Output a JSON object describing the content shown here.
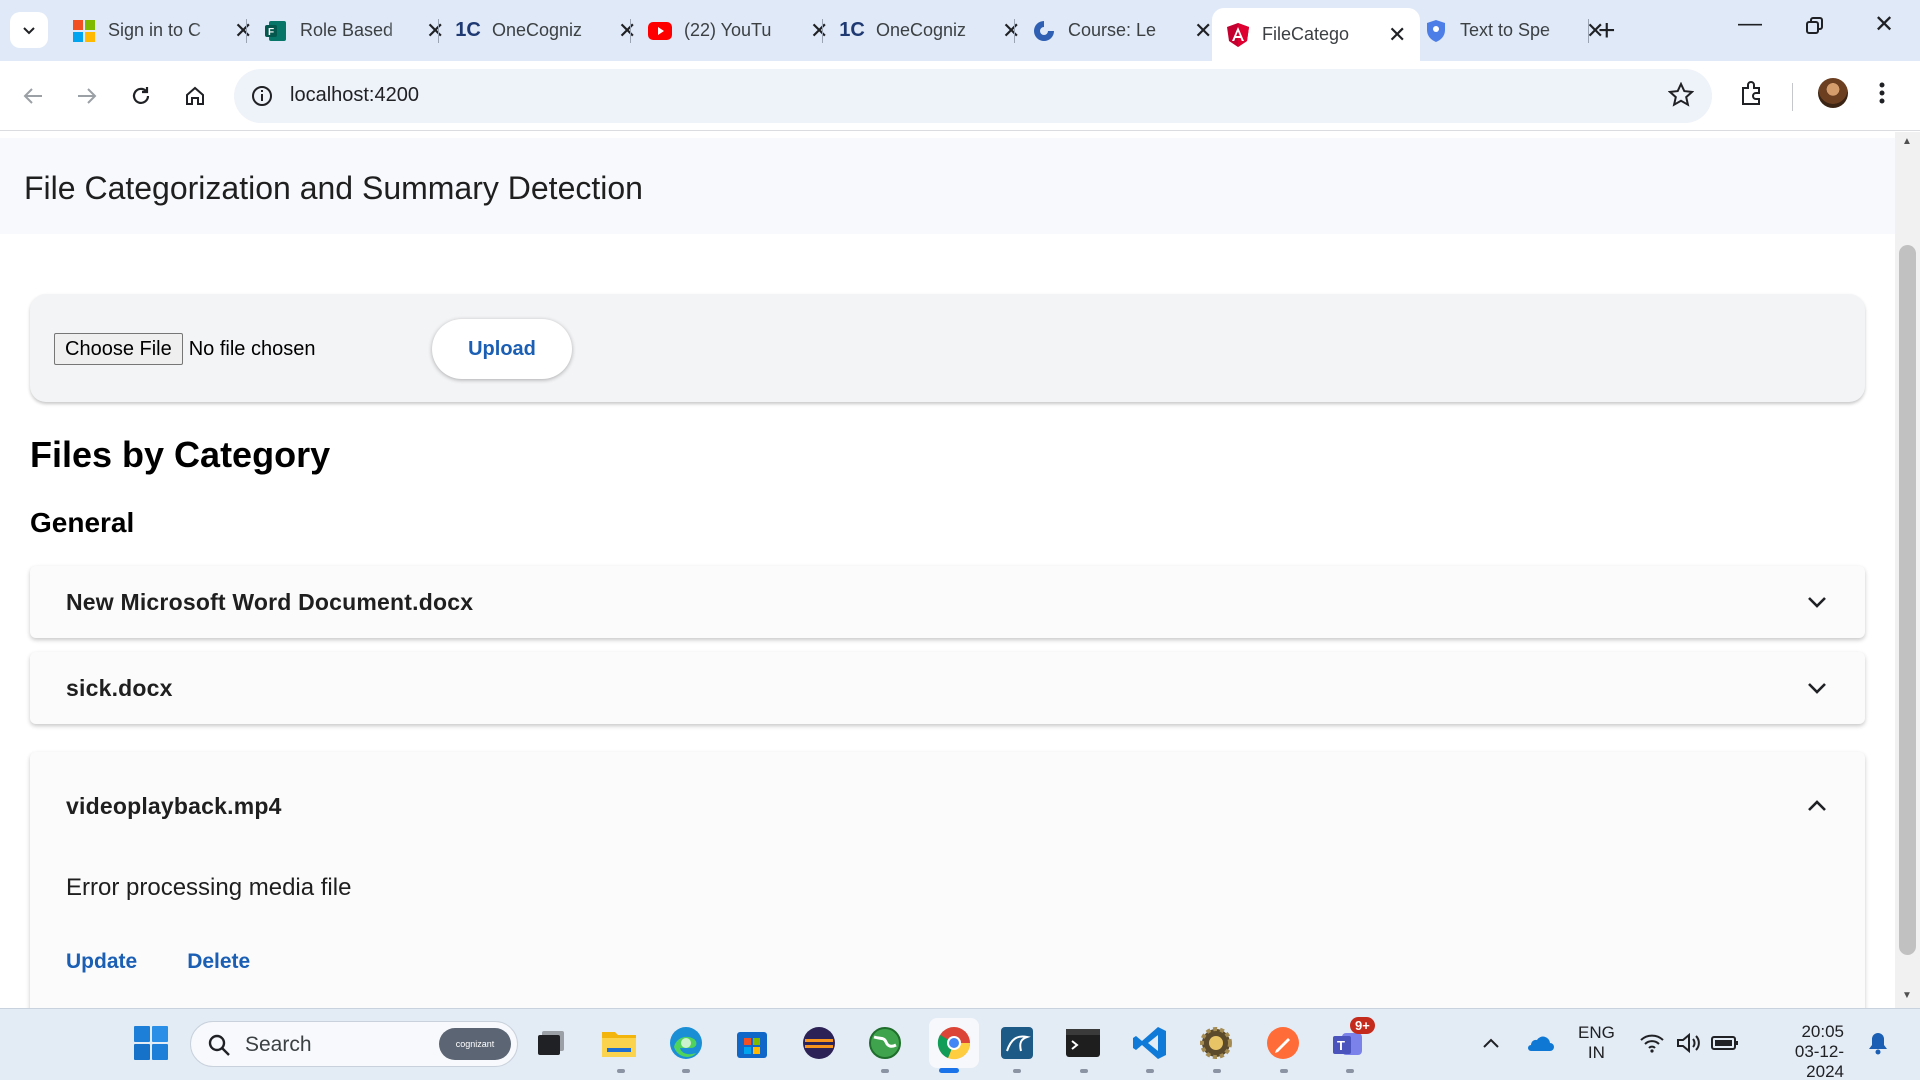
{
  "browser": {
    "tabs": [
      {
        "title": "Sign in to C",
        "icon": "microsoft-icon"
      },
      {
        "title": "Role Based",
        "icon": "forms-icon"
      },
      {
        "title": "OneCogniz",
        "icon": "onecognizant-icon"
      },
      {
        "title": "(22) YouTu",
        "icon": "youtube-icon"
      },
      {
        "title": "OneCogniz",
        "icon": "onecognizant-icon"
      },
      {
        "title": "Course: Le",
        "icon": "course-icon"
      },
      {
        "title": "FileCatego",
        "icon": "angular-icon"
      },
      {
        "title": "Text to Spe",
        "icon": "shield-icon"
      }
    ],
    "active_tab_index": 6,
    "address": "localhost:4200"
  },
  "app": {
    "title": "File Categorization and Summary Detection",
    "choose_file_label": "Choose File",
    "no_file_text": "No file chosen",
    "upload_label": "Upload",
    "files_heading": "Files by Category",
    "category": "General",
    "files": [
      {
        "name": "New Microsoft Word Document.docx",
        "expanded": false
      },
      {
        "name": "sick.docx",
        "expanded": false
      },
      {
        "name": "videoplayback.mp4",
        "expanded": true,
        "summary": "Error processing media file",
        "update_label": "Update",
        "delete_label": "Delete"
      }
    ],
    "accent_color": "#1a5fb4"
  },
  "taskbar": {
    "search_placeholder": "Search",
    "search_badge": "cognizant",
    "teams_badge": "9+",
    "language": "ENG",
    "region": "IN",
    "time": "20:05",
    "date": "03-12-2024"
  }
}
